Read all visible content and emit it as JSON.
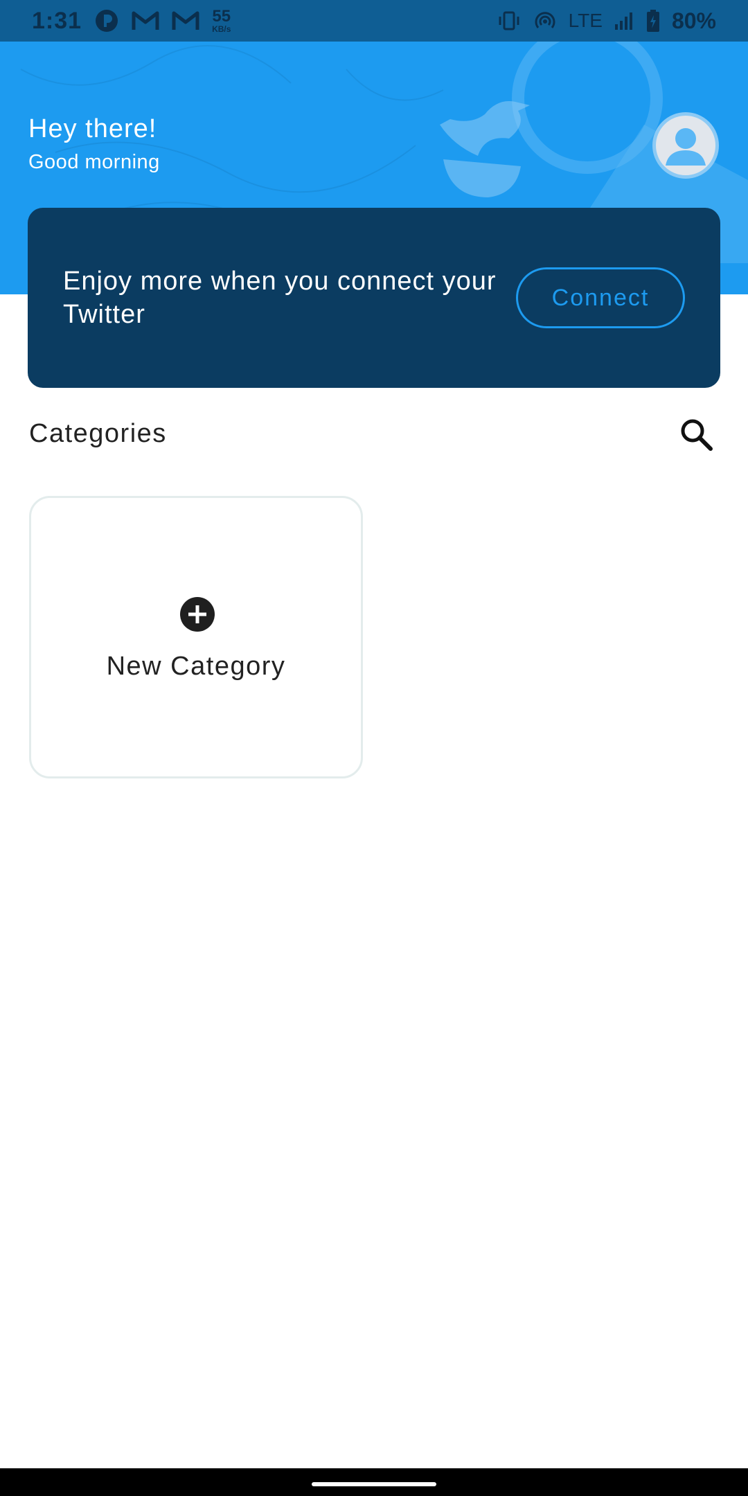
{
  "status_bar": {
    "time": "1:31",
    "net_speed_value": "55",
    "net_speed_unit": "KB/s",
    "network": "LTE",
    "battery": "80%",
    "icons": [
      "app-notification-icon",
      "gmail-icon",
      "gmail-icon",
      "vibrate-icon",
      "hotspot-icon",
      "signal-icon",
      "battery-charging-icon"
    ]
  },
  "header": {
    "greeting": "Hey there!",
    "subgreeting": "Good morning",
    "avatar_icon": "user-avatar-icon",
    "background_color": "#1d9bf0"
  },
  "connect_banner": {
    "message": "Enjoy more when you connect your Twitter",
    "button_label": "Connect",
    "background_color": "#0b3c61",
    "accent_color": "#1d9bf0"
  },
  "categories": {
    "title": "Categories",
    "search_icon": "search-icon",
    "new_category_label": "New Category",
    "new_category_icon": "plus-circle-icon"
  }
}
